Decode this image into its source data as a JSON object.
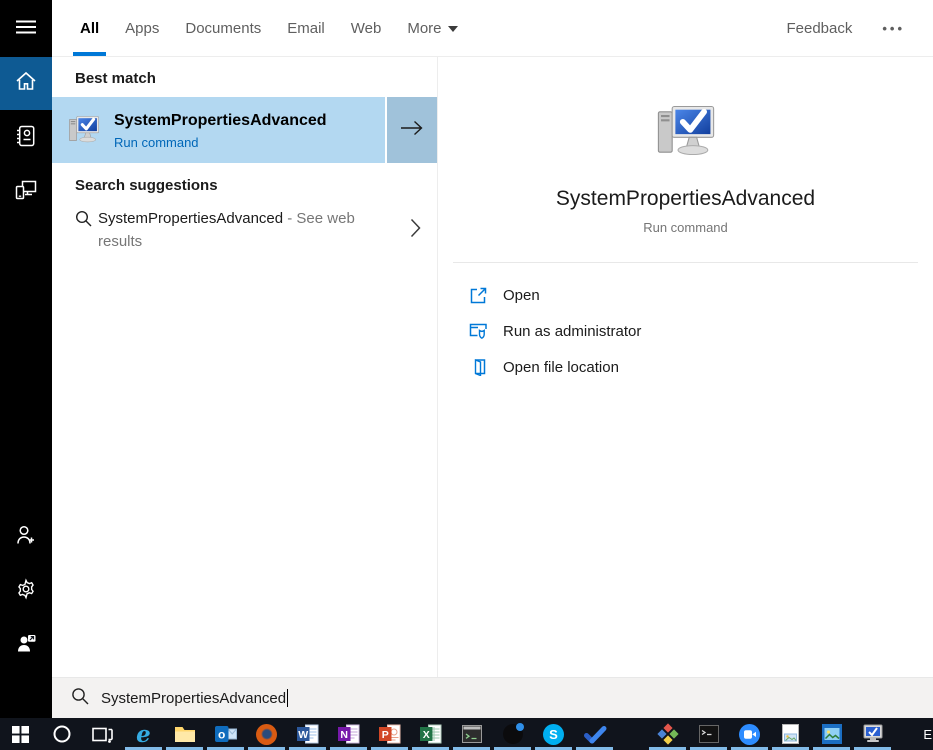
{
  "header": {
    "tabs": [
      {
        "label": "All",
        "active": true
      },
      {
        "label": "Apps",
        "active": false
      },
      {
        "label": "Documents",
        "active": false
      },
      {
        "label": "Email",
        "active": false
      },
      {
        "label": "Web",
        "active": false
      },
      {
        "label": "More",
        "active": false,
        "dropdown": true
      }
    ],
    "feedback": "Feedback",
    "ellipsis": "•••"
  },
  "sidebar": {
    "icons": [
      "menu-icon",
      "home-icon",
      "journal-icon",
      "devices-icon",
      "add-user-icon",
      "settings-gear-icon",
      "person-feedback-icon"
    ]
  },
  "left_panel": {
    "best_match": {
      "section_title": "Best match",
      "title": "SystemPropertiesAdvanced",
      "subtitle": "Run command"
    },
    "suggestions": {
      "section_title": "Search suggestions",
      "query": "SystemPropertiesAdvanced",
      "suffix": " - See web results"
    }
  },
  "preview": {
    "title": "SystemPropertiesAdvanced",
    "subtitle": "Run command",
    "actions": [
      {
        "label": "Open",
        "icon": "open-icon"
      },
      {
        "label": "Run as administrator",
        "icon": "run-as-admin-icon"
      },
      {
        "label": "Open file location",
        "icon": "open-file-location-icon"
      }
    ]
  },
  "search_box": {
    "value": "SystemPropertiesAdvanced"
  },
  "taskbar": {
    "tray_text": "E",
    "items": [
      {
        "name": "start-button",
        "glyph": "windows",
        "running": false
      },
      {
        "name": "cortana-search-button",
        "glyph": "ring",
        "running": false
      },
      {
        "name": "task-view-button",
        "glyph": "taskview",
        "running": false
      },
      {
        "name": "edge-icon",
        "glyph": "edge",
        "running": true
      },
      {
        "name": "file-explorer-icon",
        "glyph": "folder",
        "running": true
      },
      {
        "name": "outlook-icon",
        "glyph": "outlook",
        "running": true
      },
      {
        "name": "firefox-icon",
        "glyph": "firefox",
        "running": true
      },
      {
        "name": "word-icon",
        "glyph": "word",
        "running": true
      },
      {
        "name": "onenote-icon",
        "glyph": "onenote",
        "running": true
      },
      {
        "name": "powerpoint-icon",
        "glyph": "powerpoint",
        "running": true
      },
      {
        "name": "excel-icon",
        "glyph": "excel",
        "running": true
      },
      {
        "name": "command-prompt-icon",
        "glyph": "cmd",
        "running": true
      },
      {
        "name": "sphere-app-icon",
        "glyph": "sphere",
        "running": true
      },
      {
        "name": "skype-icon",
        "glyph": "skype",
        "running": true
      },
      {
        "name": "blue-check-app-icon",
        "glyph": "check",
        "running": true
      },
      {
        "name": "diamond-app-icon",
        "glyph": "diamond",
        "running": true,
        "gap_before": true
      },
      {
        "name": "terminal-icon",
        "glyph": "terminal",
        "running": true
      },
      {
        "name": "zoom-app-icon",
        "glyph": "zoomapp",
        "running": true
      },
      {
        "name": "image-viewer-icon",
        "glyph": "imagedoc",
        "running": true
      },
      {
        "name": "photos-app-icon",
        "glyph": "photos",
        "running": true
      },
      {
        "name": "system-properties-icon",
        "glyph": "computer",
        "running": true
      }
    ]
  },
  "colors": {
    "accent": "#0078d7",
    "best_match_bg": "#b3d8f1",
    "arrow_box_bg": "#a0c2da",
    "sidebar_home_bg": "#0e5a93",
    "taskbar_bg": "#10141c",
    "running_indicator": "#82bbe8",
    "link_blue": "#0067b8"
  }
}
